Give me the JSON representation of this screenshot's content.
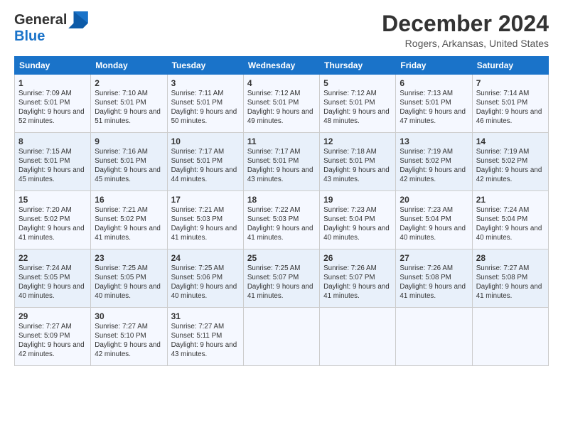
{
  "header": {
    "logo_line1": "General",
    "logo_line2": "Blue",
    "title": "December 2024",
    "subtitle": "Rogers, Arkansas, United States"
  },
  "days_of_week": [
    "Sunday",
    "Monday",
    "Tuesday",
    "Wednesday",
    "Thursday",
    "Friday",
    "Saturday"
  ],
  "weeks": [
    [
      {
        "day": "1",
        "content": "Sunrise: 7:09 AM\nSunset: 5:01 PM\nDaylight: 9 hours and 52 minutes."
      },
      {
        "day": "2",
        "content": "Sunrise: 7:10 AM\nSunset: 5:01 PM\nDaylight: 9 hours and 51 minutes."
      },
      {
        "day": "3",
        "content": "Sunrise: 7:11 AM\nSunset: 5:01 PM\nDaylight: 9 hours and 50 minutes."
      },
      {
        "day": "4",
        "content": "Sunrise: 7:12 AM\nSunset: 5:01 PM\nDaylight: 9 hours and 49 minutes."
      },
      {
        "day": "5",
        "content": "Sunrise: 7:12 AM\nSunset: 5:01 PM\nDaylight: 9 hours and 48 minutes."
      },
      {
        "day": "6",
        "content": "Sunrise: 7:13 AM\nSunset: 5:01 PM\nDaylight: 9 hours and 47 minutes."
      },
      {
        "day": "7",
        "content": "Sunrise: 7:14 AM\nSunset: 5:01 PM\nDaylight: 9 hours and 46 minutes."
      }
    ],
    [
      {
        "day": "8",
        "content": "Sunrise: 7:15 AM\nSunset: 5:01 PM\nDaylight: 9 hours and 45 minutes."
      },
      {
        "day": "9",
        "content": "Sunrise: 7:16 AM\nSunset: 5:01 PM\nDaylight: 9 hours and 45 minutes."
      },
      {
        "day": "10",
        "content": "Sunrise: 7:17 AM\nSunset: 5:01 PM\nDaylight: 9 hours and 44 minutes."
      },
      {
        "day": "11",
        "content": "Sunrise: 7:17 AM\nSunset: 5:01 PM\nDaylight: 9 hours and 43 minutes."
      },
      {
        "day": "12",
        "content": "Sunrise: 7:18 AM\nSunset: 5:01 PM\nDaylight: 9 hours and 43 minutes."
      },
      {
        "day": "13",
        "content": "Sunrise: 7:19 AM\nSunset: 5:02 PM\nDaylight: 9 hours and 42 minutes."
      },
      {
        "day": "14",
        "content": "Sunrise: 7:19 AM\nSunset: 5:02 PM\nDaylight: 9 hours and 42 minutes."
      }
    ],
    [
      {
        "day": "15",
        "content": "Sunrise: 7:20 AM\nSunset: 5:02 PM\nDaylight: 9 hours and 41 minutes."
      },
      {
        "day": "16",
        "content": "Sunrise: 7:21 AM\nSunset: 5:02 PM\nDaylight: 9 hours and 41 minutes."
      },
      {
        "day": "17",
        "content": "Sunrise: 7:21 AM\nSunset: 5:03 PM\nDaylight: 9 hours and 41 minutes."
      },
      {
        "day": "18",
        "content": "Sunrise: 7:22 AM\nSunset: 5:03 PM\nDaylight: 9 hours and 41 minutes."
      },
      {
        "day": "19",
        "content": "Sunrise: 7:23 AM\nSunset: 5:04 PM\nDaylight: 9 hours and 40 minutes."
      },
      {
        "day": "20",
        "content": "Sunrise: 7:23 AM\nSunset: 5:04 PM\nDaylight: 9 hours and 40 minutes."
      },
      {
        "day": "21",
        "content": "Sunrise: 7:24 AM\nSunset: 5:04 PM\nDaylight: 9 hours and 40 minutes."
      }
    ],
    [
      {
        "day": "22",
        "content": "Sunrise: 7:24 AM\nSunset: 5:05 PM\nDaylight: 9 hours and 40 minutes."
      },
      {
        "day": "23",
        "content": "Sunrise: 7:25 AM\nSunset: 5:05 PM\nDaylight: 9 hours and 40 minutes."
      },
      {
        "day": "24",
        "content": "Sunrise: 7:25 AM\nSunset: 5:06 PM\nDaylight: 9 hours and 40 minutes."
      },
      {
        "day": "25",
        "content": "Sunrise: 7:25 AM\nSunset: 5:07 PM\nDaylight: 9 hours and 41 minutes."
      },
      {
        "day": "26",
        "content": "Sunrise: 7:26 AM\nSunset: 5:07 PM\nDaylight: 9 hours and 41 minutes."
      },
      {
        "day": "27",
        "content": "Sunrise: 7:26 AM\nSunset: 5:08 PM\nDaylight: 9 hours and 41 minutes."
      },
      {
        "day": "28",
        "content": "Sunrise: 7:27 AM\nSunset: 5:08 PM\nDaylight: 9 hours and 41 minutes."
      }
    ],
    [
      {
        "day": "29",
        "content": "Sunrise: 7:27 AM\nSunset: 5:09 PM\nDaylight: 9 hours and 42 minutes."
      },
      {
        "day": "30",
        "content": "Sunrise: 7:27 AM\nSunset: 5:10 PM\nDaylight: 9 hours and 42 minutes."
      },
      {
        "day": "31",
        "content": "Sunrise: 7:27 AM\nSunset: 5:11 PM\nDaylight: 9 hours and 43 minutes."
      },
      {
        "day": "",
        "content": ""
      },
      {
        "day": "",
        "content": ""
      },
      {
        "day": "",
        "content": ""
      },
      {
        "day": "",
        "content": ""
      }
    ]
  ]
}
